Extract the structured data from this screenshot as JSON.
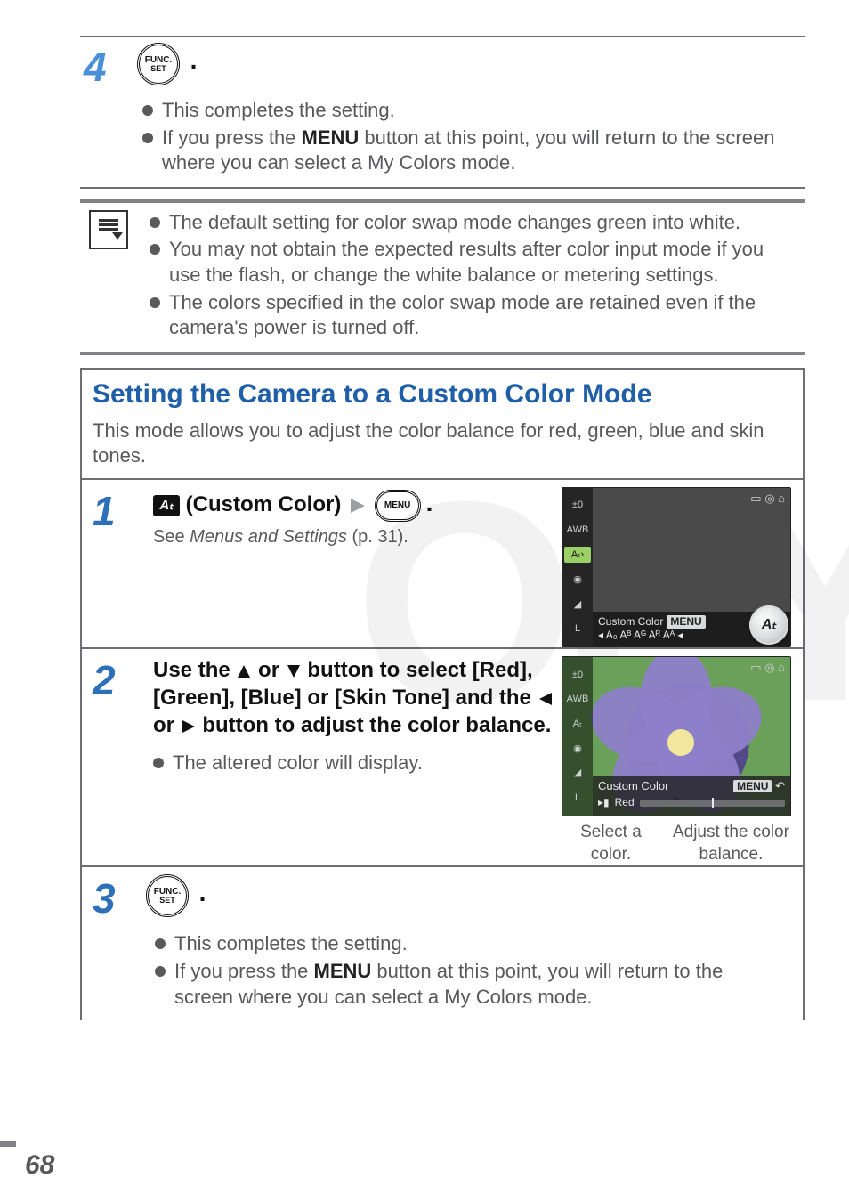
{
  "page_number": "68",
  "watermark_text": "OPY",
  "step4": {
    "num": "4",
    "func_top": "FUNC.",
    "func_bot": "SET",
    "dot": ".",
    "bullets": [
      {
        "pre": "This completes the setting."
      },
      {
        "pre": "If you press the ",
        "bold": "MENU",
        "post": " button at this point, you will return to the screen where you can select a My Colors mode."
      }
    ]
  },
  "notes": [
    "The default setting for color swap mode changes green into white.",
    "You may not obtain the expected results after color input mode if you use the flash, or change the white balance or metering settings.",
    "The colors specified in the color swap mode are retained even if the camera's power is turned off."
  ],
  "section": {
    "title": "Setting the Camera to a Custom Color Mode",
    "intro": "This mode allows you to adjust the color balance for red, green, blue and skin tones."
  },
  "step1": {
    "num": "1",
    "icon_text": "Aₜ",
    "label": " (Custom Color)",
    "menu_label": "MENU",
    "dot": ".",
    "ref_pre": "See ",
    "ref_em": "Menus and Settings",
    "ref_post": " (p. 31).",
    "shot_label1": "Custom Color",
    "shot_menu_tag": "MENU",
    "shot_row": "◂ A₀ Aᴮ Aᴳ Aᴿ Aᴬ ◂",
    "badge": "Aₜ",
    "side": [
      "±0",
      "AWB",
      "Aₜ›",
      "◉",
      "◢",
      "L"
    ]
  },
  "step2": {
    "num": "2",
    "heavy_a": "Use the ",
    "heavy_b": " or ",
    "heavy_c": " button to select [Red], [Green], [Blue] or [Skin Tone] and the ",
    "heavy_d": " or ",
    "heavy_e": " button to adjust the color balance.",
    "bullet": "The altered color will display.",
    "shot_label": "Custom Color",
    "shot_menu_tag": "MENU",
    "shot_red": "Red",
    "caption_l": "Select a color.",
    "caption_r": "Adjust the color balance.",
    "side": [
      "±0",
      "AWB",
      "Aₜ",
      "◉",
      "◢",
      "L"
    ]
  },
  "step3": {
    "num": "3",
    "func_top": "FUNC.",
    "func_bot": "SET",
    "dot": ".",
    "bullets": [
      {
        "pre": "This completes the setting."
      },
      {
        "pre": "If you press the ",
        "bold": "MENU",
        "post": " button at this point, you will return to the screen where you can select a My Colors mode."
      }
    ]
  }
}
